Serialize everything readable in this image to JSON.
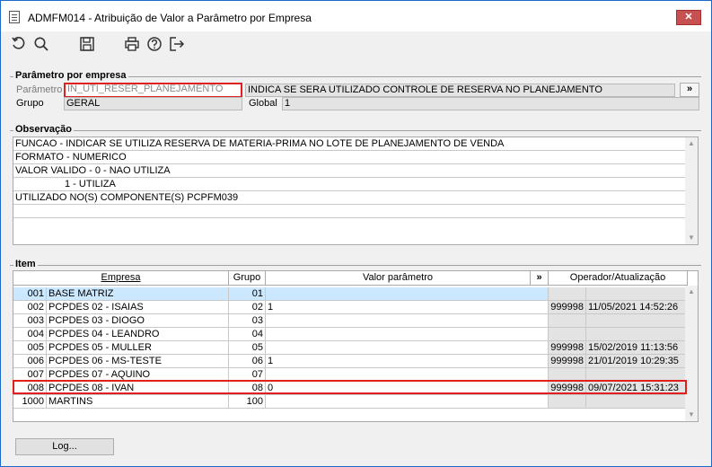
{
  "window": {
    "title": "ADMFM014 - Atribuição de Valor a Parâmetro por Empresa",
    "close_label": "✕"
  },
  "toolbar": {
    "icons": [
      "undo-icon",
      "search-icon",
      "save-icon",
      "print-icon",
      "help-icon",
      "exit-icon"
    ]
  },
  "parametro": {
    "section_title": "Parâmetro por empresa",
    "parametro_label": "Parâmetro",
    "parametro_value": "IN_UTI_RESER_PLANEJAMENTO",
    "descricao_value": "INDICA SE SERA UTILIZADO CONTROLE DE RESERVA NO PLANEJAMENTO",
    "lookup_label": "»",
    "grupo_label": "Grupo",
    "grupo_value": "GERAL",
    "global_label": "Global",
    "global_value": "1"
  },
  "observacao": {
    "section_title": "Observação",
    "lines": [
      "FUNCAO - INDICAR SE UTILIZA RESERVA DE MATERIA-PRIMA NO LOTE DE PLANEJAMENTO DE VENDA",
      "FORMATO - NUMERICO",
      "VALOR VALIDO - 0 - NAO UTILIZA",
      "                  1 - UTILIZA",
      "UTILIZADO NO(S) COMPONENTE(S) PCPFM039",
      "",
      ""
    ]
  },
  "item": {
    "section_title": "Item",
    "columns": {
      "empresa": "Empresa",
      "grupo": "Grupo",
      "valor": "Valor parâmetro",
      "expand": "»",
      "operador": "Operador/Atualização"
    },
    "rows": [
      {
        "code": "001",
        "name": "BASE MATRIZ",
        "grupo": "01",
        "valor": "",
        "operador": "",
        "data": ""
      },
      {
        "code": "002",
        "name": "PCPDES 02 - ISAIAS",
        "grupo": "02",
        "valor": "1",
        "operador": "999998",
        "data": "11/05/2021 14:52:26"
      },
      {
        "code": "003",
        "name": "PCPDES 03 - DIOGO",
        "grupo": "03",
        "valor": "",
        "operador": "",
        "data": ""
      },
      {
        "code": "004",
        "name": "PCPDES 04 - LEANDRO",
        "grupo": "04",
        "valor": "",
        "operador": "",
        "data": ""
      },
      {
        "code": "005",
        "name": "PCPDES 05 - MULLER",
        "grupo": "05",
        "valor": "",
        "operador": "999998",
        "data": "15/02/2019 11:13:56"
      },
      {
        "code": "006",
        "name": "PCPDES 06 - MS-TESTE",
        "grupo": "06",
        "valor": "1",
        "operador": "999998",
        "data": "21/01/2019 10:29:35"
      },
      {
        "code": "007",
        "name": "PCPDES 07 - AQUINO",
        "grupo": "07",
        "valor": "",
        "operador": "",
        "data": ""
      },
      {
        "code": "008",
        "name": "PCPDES 08 - IVAN",
        "grupo": "08",
        "valor": "0",
        "operador": "999998",
        "data": "09/07/2021 15:31:23"
      },
      {
        "code": "1000",
        "name": "MARTINS",
        "grupo": "100",
        "valor": "",
        "operador": "",
        "data": ""
      }
    ]
  },
  "footer": {
    "log_label": "Log..."
  }
}
